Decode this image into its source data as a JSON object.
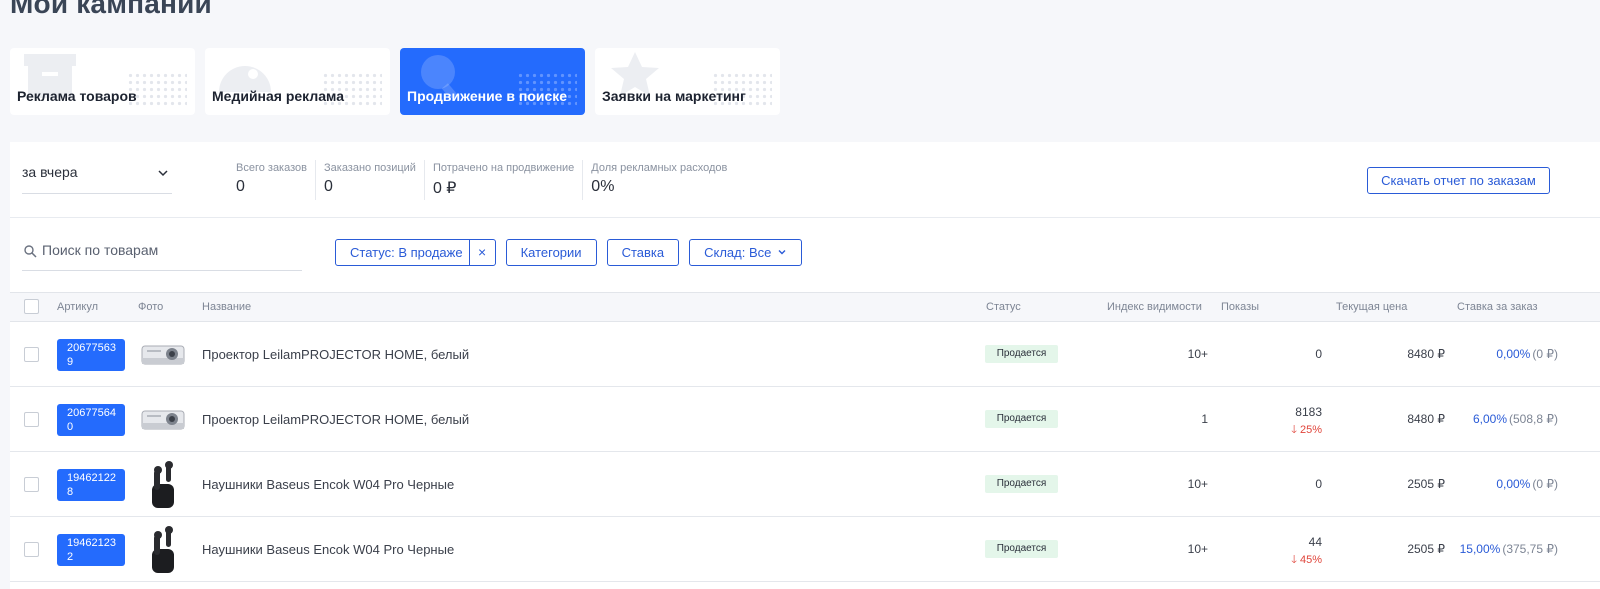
{
  "page_title": "Мои кампании",
  "campaign_cards": [
    {
      "label": "Реклама товаров",
      "icon": "box-icon",
      "active": false
    },
    {
      "label": "Медийная реклама",
      "icon": "media-icon",
      "active": false
    },
    {
      "label": "Продвижение в поиске",
      "icon": "search-promo-icon",
      "active": true
    },
    {
      "label": "Заявки на маркетинг",
      "icon": "star-icon",
      "active": false
    }
  ],
  "period": {
    "value": "за вчера"
  },
  "stats": [
    {
      "label": "Всего заказов",
      "value": "0"
    },
    {
      "label": "Заказано позиций",
      "value": "0"
    },
    {
      "label": "Потрачено на продвижение",
      "value": "0 ₽"
    },
    {
      "label": "Доля рекламных расходов",
      "value": "0%"
    }
  ],
  "report_button": "Скачать отчет по заказам",
  "search": {
    "placeholder": "Поиск по товарам",
    "value": ""
  },
  "filters": {
    "status": "Статус: В продаже",
    "status_clear": "×",
    "categories": "Категории",
    "rate": "Ставка",
    "warehouse": "Склад: Все"
  },
  "columns": {
    "sku": "Артикул",
    "photo": "Фото",
    "name": "Название",
    "status": "Статус",
    "visibility": "Индекс видимости",
    "impressions": "Показы",
    "price": "Текущая цена",
    "rate": "Ставка за заказ"
  },
  "rows": [
    {
      "sku_line1": "20677563",
      "sku_line2": "9",
      "photo": "projector",
      "name": "Проектор LeilamPROJECTOR HOME, белый",
      "status": "Продается",
      "visibility": "10+",
      "impressions": "0",
      "delta": "",
      "price": "8480 ₽",
      "rate_pct": "0,00%",
      "rate_amt": "(0 ₽)"
    },
    {
      "sku_line1": "20677564",
      "sku_line2": "0",
      "photo": "projector",
      "name": "Проектор LeilamPROJECTOR HOME, белый",
      "status": "Продается",
      "visibility": "1",
      "impressions": "8183",
      "delta": "🡓 25%",
      "price": "8480 ₽",
      "rate_pct": "6,00%",
      "rate_amt": "(508,8 ₽)"
    },
    {
      "sku_line1": "19462122",
      "sku_line2": "8",
      "photo": "earbuds",
      "name": "Наушники Baseus Encok W04 Pro Черные",
      "status": "Продается",
      "visibility": "10+",
      "impressions": "0",
      "delta": "",
      "price": "2505 ₽",
      "rate_pct": "0,00%",
      "rate_amt": "(0 ₽)"
    },
    {
      "sku_line1": "19462123",
      "sku_line2": "2",
      "photo": "earbuds",
      "name": "Наушники Baseus Encok W04 Pro Черные",
      "status": "Продается",
      "visibility": "10+",
      "impressions": "44",
      "delta": "🡓 45%",
      "price": "2505 ₽",
      "rate_pct": "15,00%",
      "rate_amt": "(375,75 ₽)"
    }
  ],
  "colors": {
    "accent": "#246bfd",
    "link": "#2a5bd7",
    "down": "#e0453b",
    "badge_bg": "#e4f6ea"
  }
}
